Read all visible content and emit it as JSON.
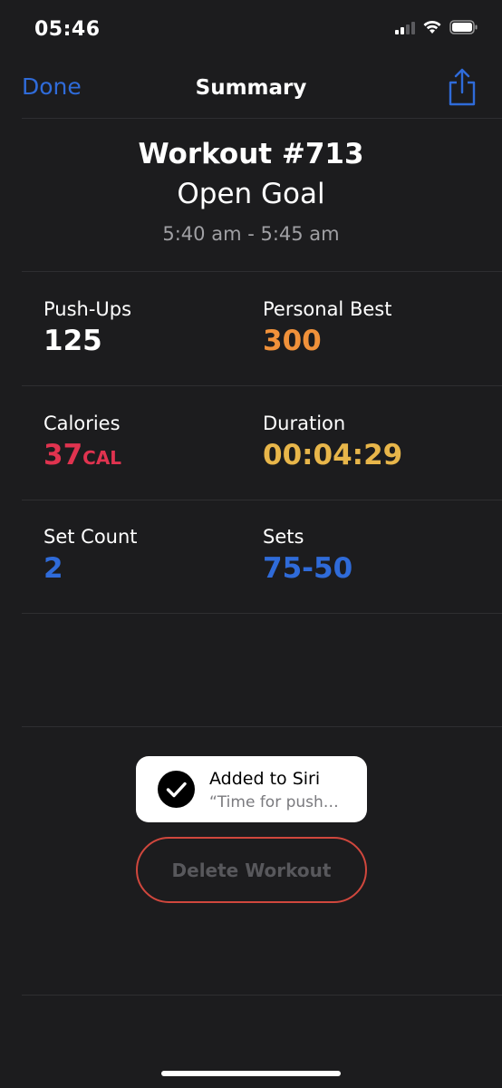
{
  "status_bar": {
    "time": "05:46",
    "icons": [
      "cellular-signal-icon",
      "wifi-icon",
      "battery-icon"
    ]
  },
  "nav": {
    "done_label": "Done",
    "title": "Summary",
    "share_icon": "share-icon"
  },
  "header": {
    "workout_title": "Workout #713",
    "goal": "Open Goal",
    "time_range": "5:40 am - 5:45 am"
  },
  "stats": {
    "pushups": {
      "label": "Push-Ups",
      "value": "125"
    },
    "personal_best": {
      "label": "Personal Best",
      "value": "300"
    },
    "calories": {
      "label": "Calories",
      "value": "37",
      "unit": "CAL"
    },
    "duration": {
      "label": "Duration",
      "value": "00:04:29"
    },
    "set_count": {
      "label": "Set Count",
      "value": "2"
    },
    "sets": {
      "label": "Sets",
      "value": "75-50"
    }
  },
  "toast": {
    "title": "Added to Siri",
    "subtitle": "“Time for push…",
    "icon": "checkmark-circle-icon"
  },
  "actions": {
    "delete_label": "Delete Workout"
  },
  "colors": {
    "background": "#1c1c1e",
    "accent_blue": "#2f6bd9",
    "orange": "#f0913a",
    "red": "#e0334f",
    "yellow": "#e8b64a",
    "delete_border": "#d0473d"
  }
}
